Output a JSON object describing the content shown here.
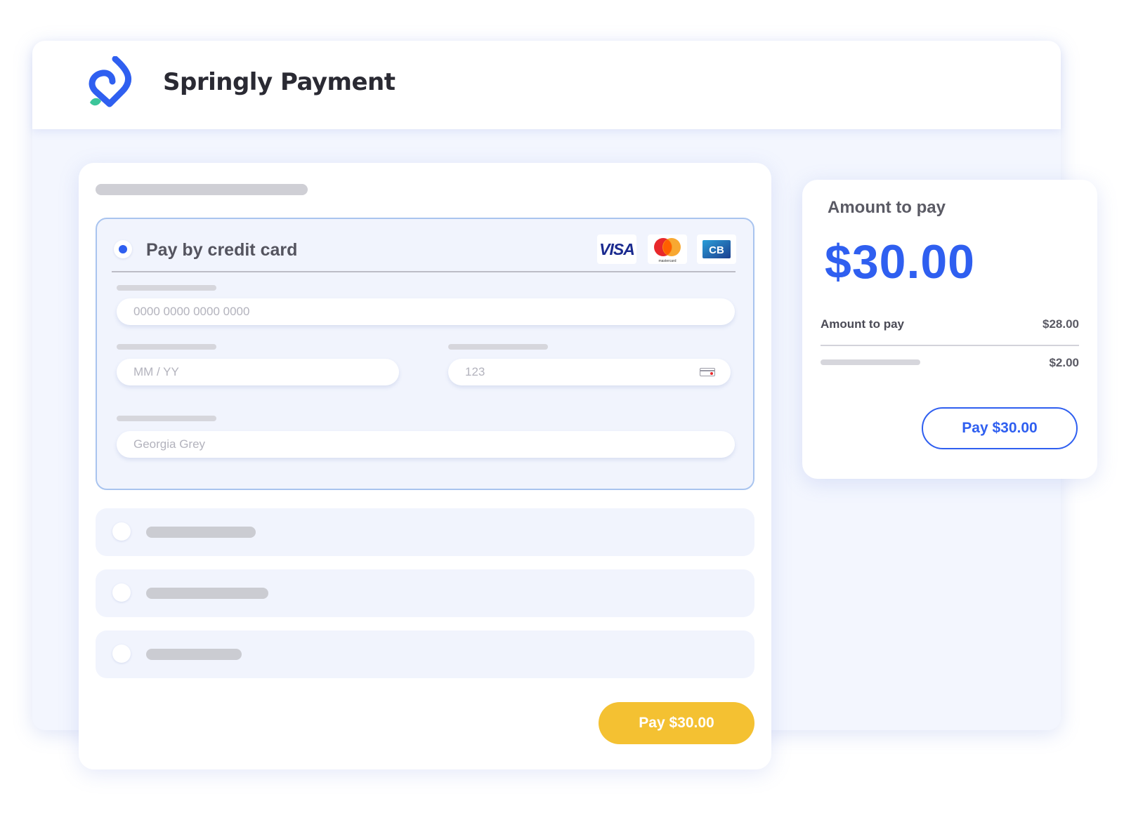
{
  "header": {
    "title": "Springly Payment",
    "logo_icon": "springly-logo"
  },
  "payment": {
    "credit_card": {
      "label": "Pay by credit card",
      "selected": true,
      "brands": [
        "VISA",
        "mastercard",
        "CB"
      ],
      "card_number": {
        "placeholder": "0000 0000 0000 0000",
        "value": ""
      },
      "expiry": {
        "placeholder": "MM / YY",
        "value": ""
      },
      "cvc": {
        "placeholder": "123",
        "value": "",
        "icon": "card-cvc-icon"
      },
      "cardholder": {
        "placeholder": "Georgia Grey",
        "value": ""
      }
    },
    "other_methods_count": 3,
    "pay_button_label": "Pay $30.00"
  },
  "summary": {
    "title": "Amount to pay",
    "total": "$30.00",
    "rows": [
      {
        "label": "Amount to pay",
        "value": "$28.00"
      },
      {
        "label": "",
        "value": "$2.00"
      }
    ],
    "pay_button_label": "Pay $30.00"
  },
  "colors": {
    "accent_blue": "#2f5ff0",
    "button_yellow": "#f4c132",
    "panel_bg": "#f1f4fd",
    "logo_green": "#3cc59a"
  }
}
